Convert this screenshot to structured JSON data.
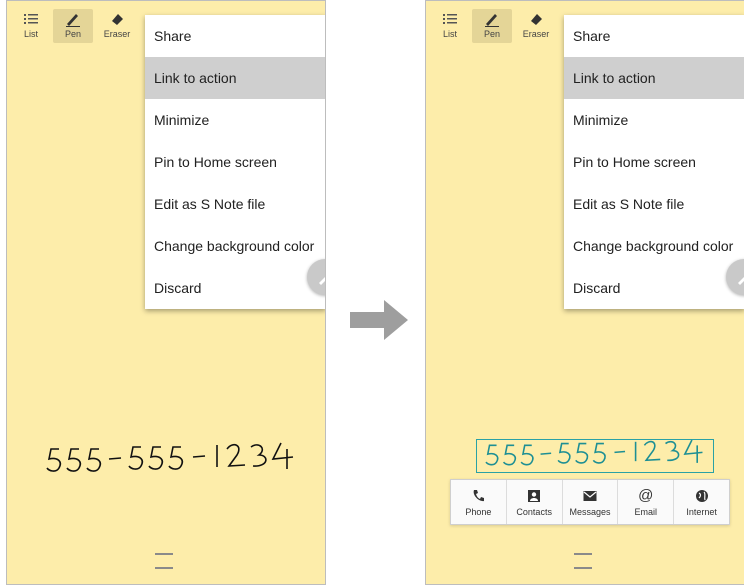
{
  "toolbar": {
    "list_label": "List",
    "pen_label": "Pen",
    "eraser_label": "Eraser"
  },
  "menu": {
    "items": [
      "Share",
      "Link to action",
      "Minimize",
      "Pin to Home screen",
      "Edit as S Note file",
      "Change background color",
      "Discard"
    ],
    "highlighted_index": 1
  },
  "note": {
    "handwriting": "555-555-1234",
    "background_color": "#fdedaa",
    "selection_color": "#2aa1a5"
  },
  "actions": {
    "phone": "Phone",
    "contacts": "Contacts",
    "messages": "Messages",
    "email": "Email",
    "internet": "Internet"
  },
  "icons": {
    "list": "list-icon",
    "pen": "pen-icon",
    "eraser": "eraser-icon",
    "edit": "pencil-icon",
    "handle": "drag-handle-icon",
    "arrow": "right-arrow-icon"
  }
}
